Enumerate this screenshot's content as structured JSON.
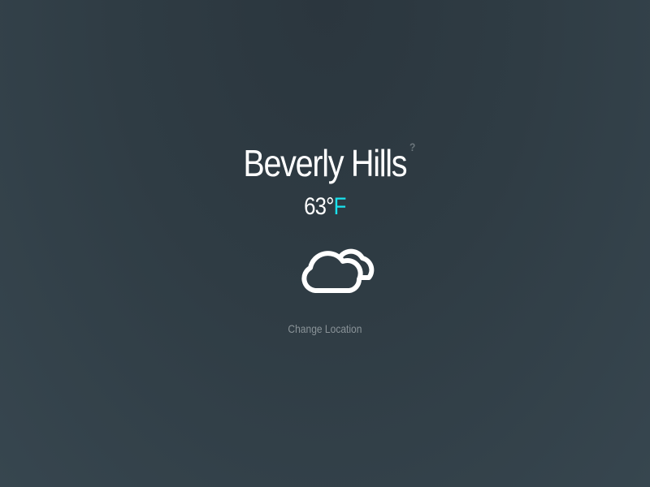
{
  "location": {
    "city": "Beverly Hills",
    "help_mark": "?"
  },
  "temperature": {
    "value": "63°",
    "unit": "F"
  },
  "condition": {
    "icon": "cloudy-icon"
  },
  "actions": {
    "change_location_label": "Change Location"
  },
  "colors": {
    "accent": "#19e3ee",
    "background": "#2f3c44",
    "muted_text": "#8a9398"
  }
}
